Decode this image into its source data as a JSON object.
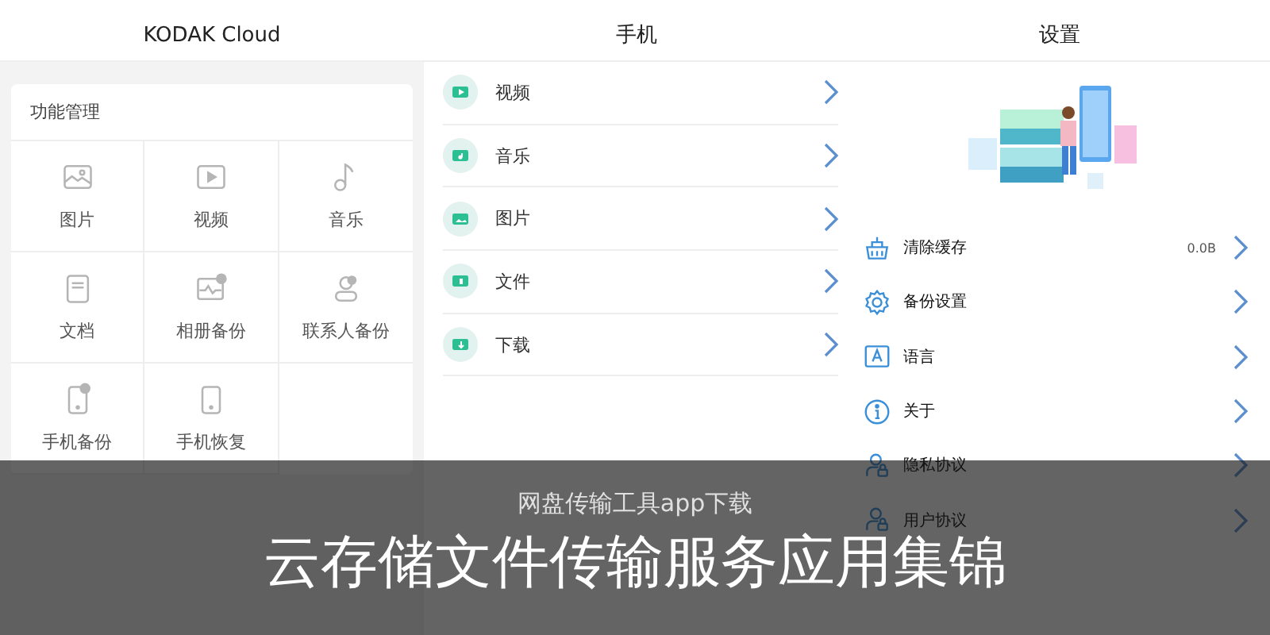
{
  "kodak_screen": {
    "title": "KODAK Cloud",
    "section_title": "功能管理",
    "items": [
      {
        "label": "图片"
      },
      {
        "label": "视频"
      },
      {
        "label": "音乐"
      },
      {
        "label": "文档"
      },
      {
        "label": "相册备份"
      },
      {
        "label": "联系人备份"
      },
      {
        "label": "手机备份"
      },
      {
        "label": "手机恢复"
      }
    ]
  },
  "phone_screen": {
    "title": "手机",
    "items": [
      {
        "label": "视频"
      },
      {
        "label": "音乐"
      },
      {
        "label": "图片"
      },
      {
        "label": "文件"
      },
      {
        "label": "下载"
      }
    ]
  },
  "settings_screen": {
    "title": "设置",
    "items": [
      {
        "label": "清除缓存",
        "value": "0.0B"
      },
      {
        "label": "备份设置"
      },
      {
        "label": "语言"
      },
      {
        "label": "关于"
      },
      {
        "label": "隐私协议"
      },
      {
        "label": "用户协议"
      }
    ]
  },
  "banner": {
    "subtitle": "网盘传输工具app下载",
    "title": "云存储文件传输服务应用集锦"
  }
}
